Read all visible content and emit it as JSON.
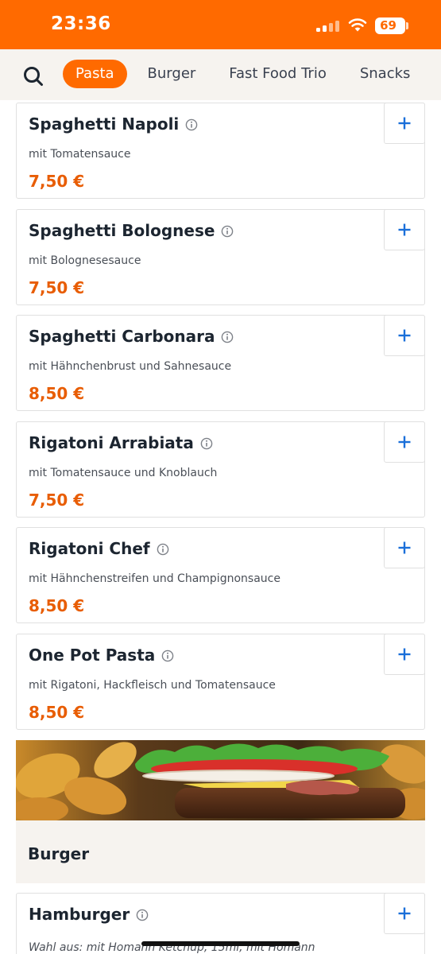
{
  "status_bar": {
    "time": "23:36",
    "battery": "69",
    "icons": [
      "cellular-signal-icon",
      "wifi-icon",
      "battery-icon"
    ],
    "background_color": "#ff6a00"
  },
  "category_nav": {
    "search_icon": "search-icon",
    "tabs": [
      {
        "label": "Pasta",
        "active": true
      },
      {
        "label": "Burger",
        "active": false
      },
      {
        "label": "Fast Food Trio",
        "active": false
      },
      {
        "label": "Snacks",
        "active": false
      }
    ],
    "active_color": "#ff6a00"
  },
  "items": [
    {
      "name": "Spaghetti Napoli",
      "description": "mit Tomatensauce",
      "price": "7,50 €"
    },
    {
      "name": "Spaghetti Bolognese",
      "description": "mit Bolognesesauce",
      "price": "7,50 €"
    },
    {
      "name": "Spaghetti Carbonara",
      "description": "mit Hähnchenbrust und Sahnesauce",
      "price": "8,50 €"
    },
    {
      "name": "Rigatoni Arrabiata",
      "description": "mit Tomatensauce und Knoblauch",
      "price": "7,50 €"
    },
    {
      "name": "Rigatoni Chef",
      "description": "mit Hähnchenstreifen und Champignonsauce",
      "price": "8,50 €"
    },
    {
      "name": "One Pot Pasta",
      "description": "mit Rigatoni, Hackfleisch und Tomatensauce",
      "price": "8,50 €"
    }
  ],
  "burger_section": {
    "title": "Burger",
    "first_item": {
      "name": "Hamburger",
      "description": "Wahl aus: mit Homann Ketchup, 15ml, mit Homann"
    }
  },
  "colors": {
    "price": "#e85d04",
    "add_icon": "#1a6fd9"
  }
}
